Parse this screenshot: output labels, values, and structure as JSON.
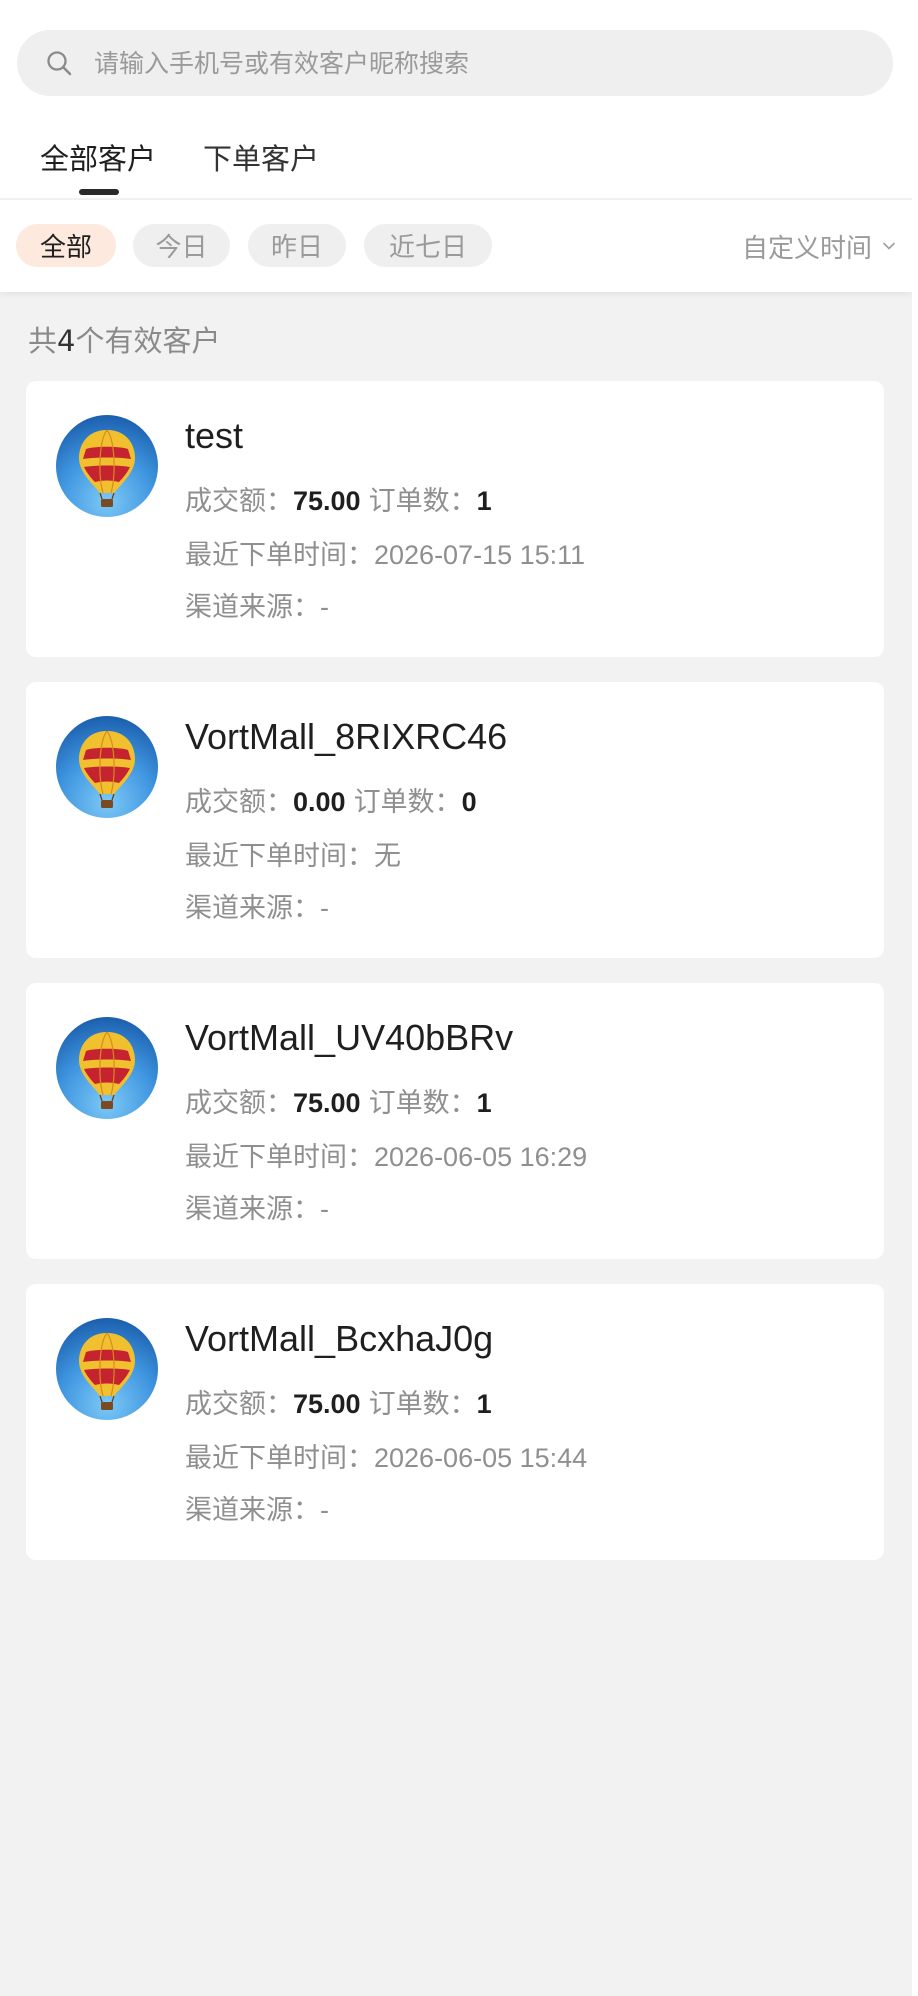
{
  "search": {
    "placeholder": "请输入手机号或有效客户昵称搜索",
    "value": "",
    "icon": "search-icon"
  },
  "tabs": [
    {
      "label": "全部客户",
      "active": true
    },
    {
      "label": "下单客户",
      "active": false
    }
  ],
  "filters": {
    "chips": [
      {
        "label": "全部",
        "active": true
      },
      {
        "label": "今日",
        "active": false
      },
      {
        "label": "昨日",
        "active": false
      },
      {
        "label": "近七日",
        "active": false
      }
    ],
    "custom_time_label": "自定义时间",
    "custom_time_icon": "chevron-down-icon"
  },
  "summary": {
    "prefix": "共",
    "count": "4",
    "suffix": "个有效客户"
  },
  "labels": {
    "amount": "成交额：",
    "orders": "订单数：",
    "last_order": "最近下单时间：",
    "channel": "渠道来源："
  },
  "customers": [
    {
      "name": "test",
      "amount": "75.00",
      "orders": "1",
      "last_order": "2026-07-15 15:11",
      "channel": "-",
      "avatar": "hot-air-balloon-avatar"
    },
    {
      "name": "VortMall_8RIXRC46",
      "amount": "0.00",
      "orders": "0",
      "last_order": "无",
      "channel": "-",
      "avatar": "hot-air-balloon-avatar"
    },
    {
      "name": "VortMall_UV40bBRv",
      "amount": "75.00",
      "orders": "1",
      "last_order": "2026-06-05 16:29",
      "channel": "-",
      "avatar": "hot-air-balloon-avatar"
    },
    {
      "name": "VortMall_BcxhaJ0g",
      "amount": "75.00",
      "orders": "1",
      "last_order": "2026-06-05 15:44",
      "channel": "-",
      "avatar": "hot-air-balloon-avatar"
    }
  ],
  "colors": {
    "background": "#f2f2f2",
    "card": "#ffffff",
    "active_chip_bg": "#fde9dd",
    "muted_text": "#8f8f8f",
    "strong_text": "#1f1f1f",
    "avatar_sky": "#2f86d6"
  }
}
